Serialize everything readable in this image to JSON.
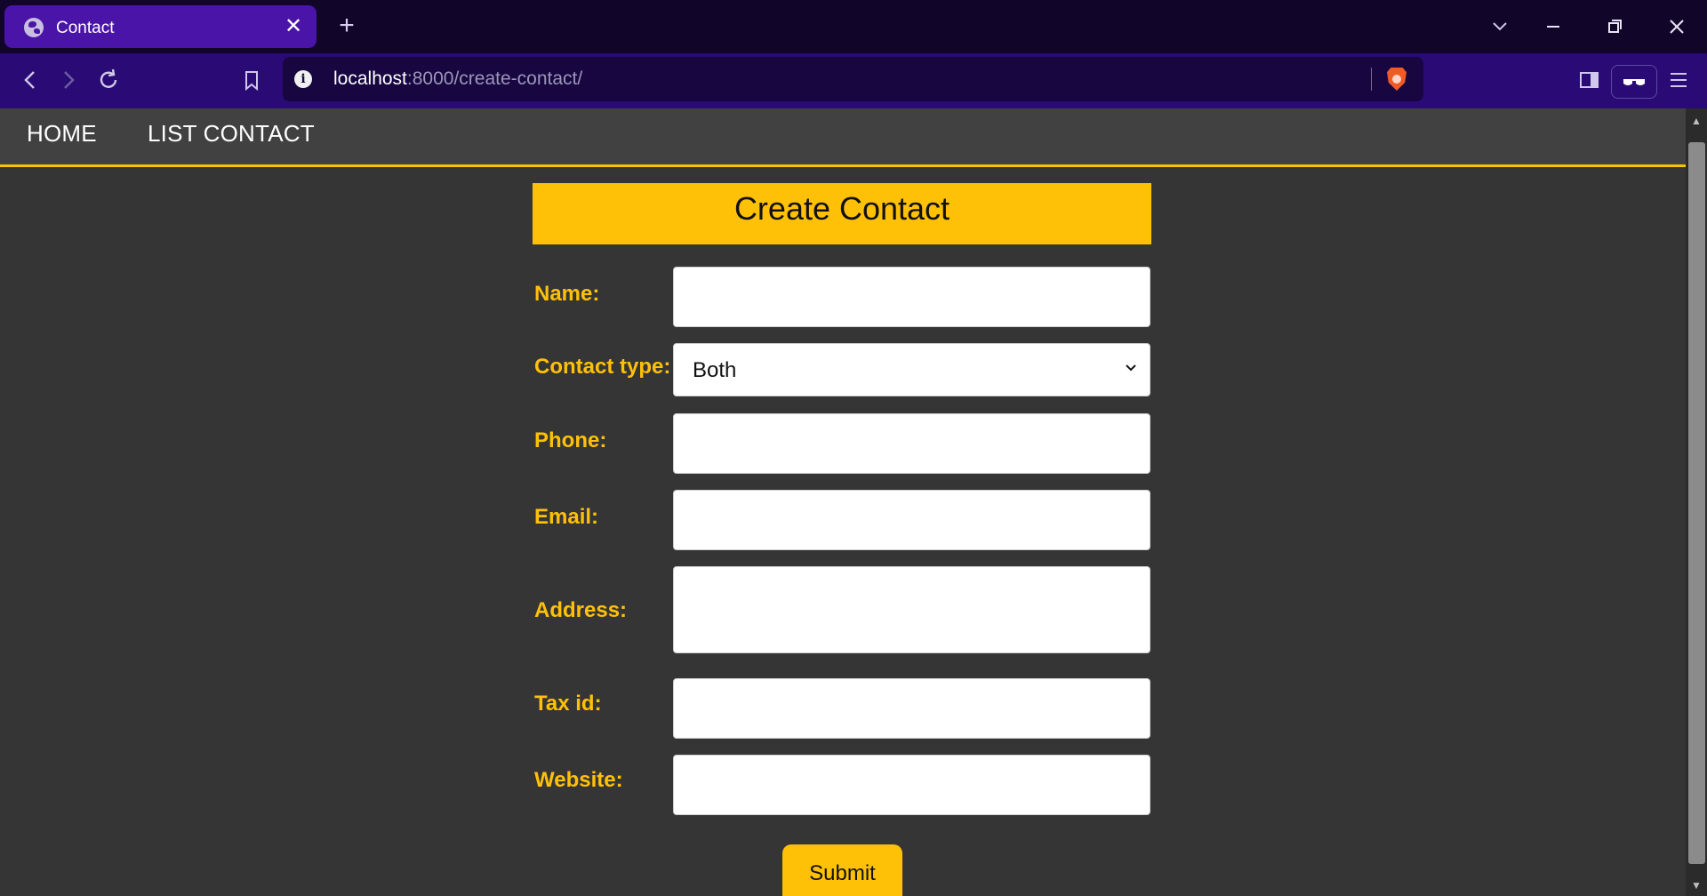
{
  "browser": {
    "tab_title": "Contact",
    "tab_close": "✕",
    "new_tab": "+",
    "url_host": "localhost",
    "url_rest": ":8000/create-contact/",
    "icons": [
      "globe-icon",
      "back-icon",
      "forward-icon",
      "reload-icon",
      "bookmark-icon",
      "info-icon",
      "brave-icon",
      "sidebar-icon",
      "reader-icon",
      "menu-icon",
      "chevron-down-icon",
      "minimize-icon",
      "restore-icon",
      "close-icon"
    ]
  },
  "nav": {
    "home": "HOME",
    "list_contact": "LIST CONTACT"
  },
  "form": {
    "title": "Create Contact",
    "labels": {
      "name": "Name:",
      "contact_type": "Contact type:",
      "phone": "Phone:",
      "email": "Email:",
      "address": "Address:",
      "tax_id": "Tax id:",
      "website": "Website:"
    },
    "values": {
      "name": "",
      "contact_type": "Both",
      "phone": "",
      "email": "",
      "address": "",
      "tax_id": "",
      "website": ""
    },
    "submit": "Submit"
  },
  "colors": {
    "accent": "#ffc107",
    "page_bg": "#353535",
    "nav_bg": "#414141",
    "browser_tab": "#4b14a8",
    "browser_toolbar": "#2a0a75"
  }
}
